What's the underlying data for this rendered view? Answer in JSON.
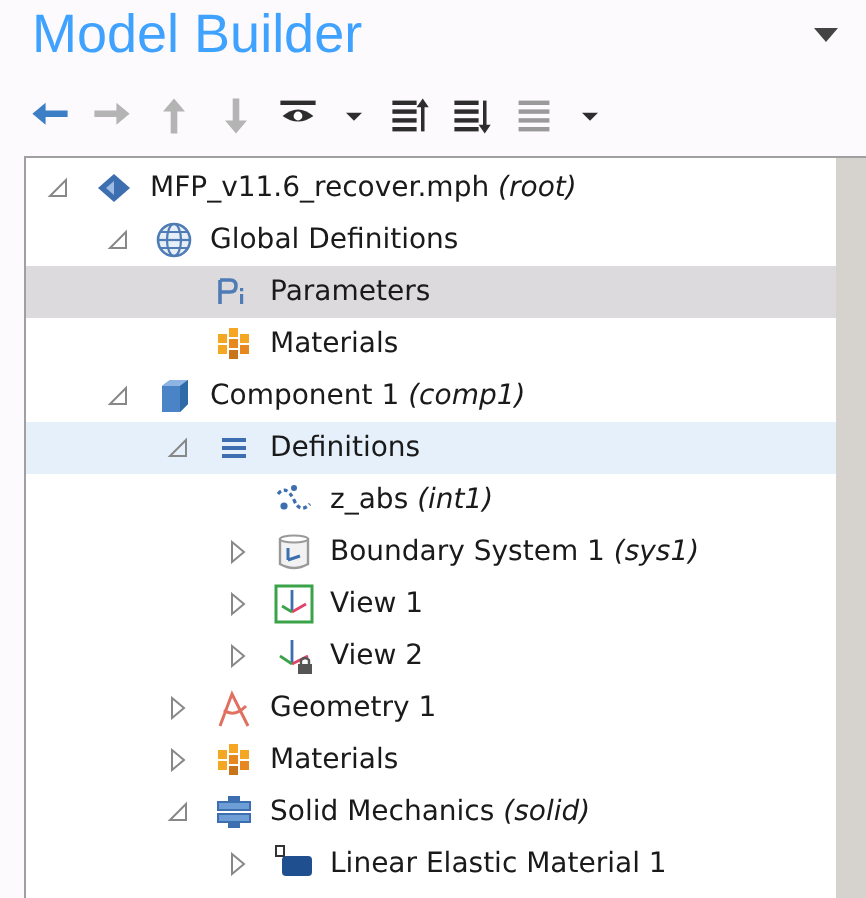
{
  "panel": {
    "title": "Model Builder"
  },
  "toolbar": [
    {
      "kind": "back",
      "disabled": false
    },
    {
      "kind": "forward",
      "disabled": true
    },
    {
      "kind": "up",
      "disabled": true
    },
    {
      "kind": "down",
      "disabled": true
    },
    {
      "kind": "eye",
      "disabled": false
    },
    {
      "kind": "dropdown",
      "disabled": false
    },
    {
      "kind": "expand",
      "disabled": false
    },
    {
      "kind": "collapse",
      "disabled": false
    },
    {
      "kind": "list",
      "disabled": true
    },
    {
      "kind": "dropdown",
      "disabled": false
    }
  ],
  "tree": [
    {
      "kind": "root",
      "label": "MFP_v11.6_recover.mph",
      "tag": "(root)",
      "expanded": true,
      "selected": false,
      "hovered": false,
      "children": [
        {
          "kind": "globe",
          "label": "Global Definitions",
          "expanded": true,
          "selected": false,
          "hovered": false,
          "children": [
            {
              "kind": "parameters",
              "label": "Parameters",
              "selected": true,
              "hovered": false
            },
            {
              "kind": "materials",
              "label": "Materials",
              "selected": false,
              "hovered": false
            }
          ]
        },
        {
          "kind": "component",
          "label": "Component 1",
          "tag": "(comp1)",
          "expanded": true,
          "selected": false,
          "hovered": false,
          "children": [
            {
              "kind": "definitions",
              "label": "Definitions",
              "expanded": true,
              "selected": false,
              "hovered": true,
              "children": [
                {
                  "kind": "interpolation",
                  "label": "z_abs",
                  "tag": "(int1)",
                  "selected": false,
                  "hovered": false
                },
                {
                  "kind": "boundary",
                  "label": "Boundary System 1",
                  "tag": "(sys1)",
                  "expanded": false,
                  "selected": false,
                  "hovered": false
                },
                {
                  "kind": "view",
                  "label": "View 1",
                  "expanded": false,
                  "selected": false,
                  "hovered": false
                },
                {
                  "kind": "view-locked",
                  "label": "View 2",
                  "expanded": false,
                  "selected": false,
                  "hovered": false
                }
              ]
            },
            {
              "kind": "geometry",
              "label": "Geometry 1",
              "expanded": false,
              "selected": false,
              "hovered": false
            },
            {
              "kind": "materials",
              "label": "Materials",
              "expanded": false,
              "selected": false,
              "hovered": false
            },
            {
              "kind": "solid",
              "label": "Solid Mechanics",
              "tag": "(solid)",
              "expanded": true,
              "selected": false,
              "hovered": false,
              "children": [
                {
                  "kind": "elastic",
                  "label": "Linear Elastic Material 1",
                  "expanded": false,
                  "selected": false,
                  "hovered": false
                }
              ]
            }
          ]
        }
      ]
    }
  ]
}
